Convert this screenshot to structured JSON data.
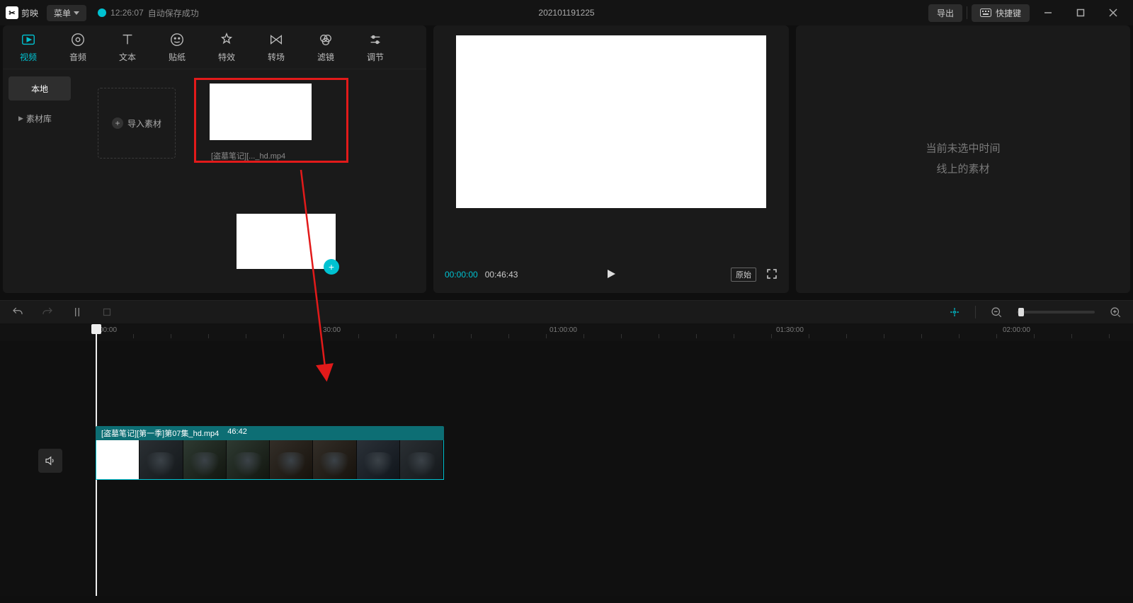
{
  "titlebar": {
    "app_name": "剪映",
    "menu_label": "菜单",
    "save_time": "12:26:07",
    "save_msg": "自动保存成功",
    "project_name": "202101191225",
    "export_label": "导出",
    "shortcut_label": "快捷键"
  },
  "tool_tabs": [
    {
      "id": "video",
      "label": "视频",
      "icon": "video"
    },
    {
      "id": "audio",
      "label": "音频",
      "icon": "audio"
    },
    {
      "id": "text",
      "label": "文本",
      "icon": "text"
    },
    {
      "id": "sticker",
      "label": "贴纸",
      "icon": "sticker"
    },
    {
      "id": "effect",
      "label": "特效",
      "icon": "effect"
    },
    {
      "id": "transition",
      "label": "转场",
      "icon": "transition"
    },
    {
      "id": "filter",
      "label": "滤镜",
      "icon": "filter"
    },
    {
      "id": "adjust",
      "label": "调节",
      "icon": "adjust"
    }
  ],
  "side": {
    "local": "本地",
    "library": "素材库"
  },
  "media": {
    "import_label": "导入素材",
    "clip_filename": "[盗墓笔记][..._hd.mp4"
  },
  "preview": {
    "current": "00:00:00",
    "duration": "00:46:43",
    "ratio_label": "原始"
  },
  "right_panel": {
    "line1": "当前未选中时间",
    "line2": "线上的素材"
  },
  "ruler": {
    "stamps": [
      "00:00",
      "30:00",
      "01:00:00",
      "01:30:00",
      "02:00:00"
    ]
  },
  "timeline_clip": {
    "title": "[盗墓笔记][第一季]第07集_hd.mp4",
    "dur": "46:42"
  }
}
